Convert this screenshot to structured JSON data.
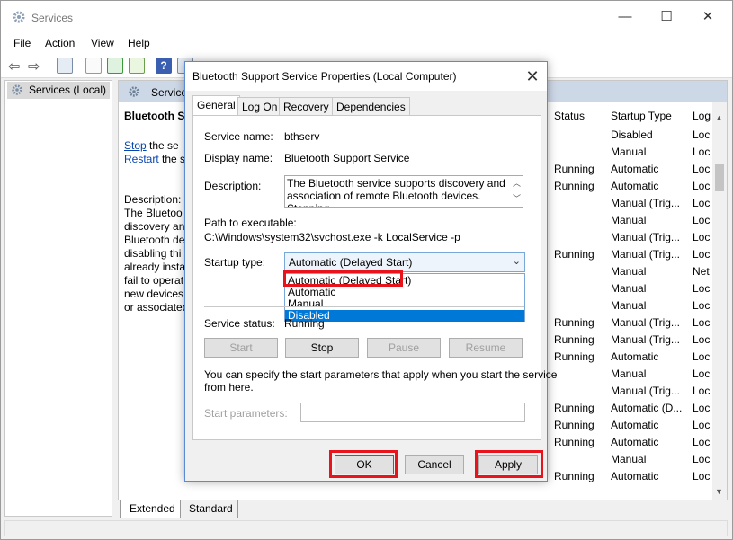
{
  "window": {
    "title": "Services",
    "minimize": "—",
    "maximize": "☐",
    "close": "✕"
  },
  "menu": [
    "File",
    "Action",
    "View",
    "Help"
  ],
  "tree": {
    "root_label": "Services (Local)"
  },
  "right_pane": {
    "header": "Services",
    "service_title": "Bluetooth S",
    "stop_link": "Stop",
    "stop_suffix": " the se",
    "restart_link": "Restart",
    "restart_suffix": " the se",
    "description_label": "Description:",
    "description_lines": [
      "The Bluetoo",
      "discovery an",
      "Bluetooth de",
      "disabling thi",
      "already insta",
      "fail to operat",
      "new devices",
      "or associated"
    ],
    "columns": {
      "status": "Status",
      "startup_type": "Startup Type",
      "log_on": "Log"
    },
    "rows": [
      {
        "status": "",
        "startup": "Disabled",
        "log": "Loc"
      },
      {
        "status": "",
        "startup": "Manual",
        "log": "Loc"
      },
      {
        "status": "Running",
        "startup": "Automatic",
        "log": "Loc"
      },
      {
        "status": "Running",
        "startup": "Automatic",
        "log": "Loc"
      },
      {
        "status": "",
        "startup": "Manual (Trig...",
        "log": "Loc"
      },
      {
        "status": "",
        "startup": "Manual",
        "log": "Loc"
      },
      {
        "status": "",
        "startup": "Manual (Trig...",
        "log": "Loc"
      },
      {
        "status": "Running",
        "startup": "Manual (Trig...",
        "log": "Loc"
      },
      {
        "status": "",
        "startup": "Manual",
        "log": "Net"
      },
      {
        "status": "",
        "startup": "Manual",
        "log": "Loc"
      },
      {
        "status": "",
        "startup": "Manual",
        "log": "Loc"
      },
      {
        "status": "Running",
        "startup": "Manual (Trig...",
        "log": "Loc"
      },
      {
        "status": "Running",
        "startup": "Manual (Trig...",
        "log": "Loc"
      },
      {
        "status": "Running",
        "startup": "Automatic",
        "log": "Loc"
      },
      {
        "status": "",
        "startup": "Manual",
        "log": "Loc"
      },
      {
        "status": "",
        "startup": "Manual (Trig...",
        "log": "Loc"
      },
      {
        "status": "Running",
        "startup": "Automatic (D...",
        "log": "Loc"
      },
      {
        "status": "Running",
        "startup": "Automatic",
        "log": "Loc"
      },
      {
        "status": "Running",
        "startup": "Automatic",
        "log": "Loc"
      },
      {
        "status": "",
        "startup": "Manual",
        "log": "Loc"
      },
      {
        "status": "Running",
        "startup": "Automatic",
        "log": "Loc"
      }
    ]
  },
  "bottom_tabs": [
    "Extended",
    "Standard"
  ],
  "dialog": {
    "title": "Bluetooth Support Service Properties (Local Computer)",
    "tabs": [
      "General",
      "Log On",
      "Recovery",
      "Dependencies"
    ],
    "service_name_label": "Service name:",
    "service_name_value": "bthserv",
    "display_name_label": "Display name:",
    "display_name_value": "Bluetooth Support Service",
    "description_label": "Description:",
    "description_value": "The Bluetooth service supports discovery and association of remote Bluetooth devices.  Stopping",
    "path_label": "Path to executable:",
    "path_value": "C:\\Windows\\system32\\svchost.exe -k LocalService -p",
    "startup_label": "Startup type:",
    "startup_selected": "Automatic (Delayed Start)",
    "startup_options": [
      "Automatic (Delayed Start)",
      "Automatic",
      "Manual",
      "Disabled"
    ],
    "status_label": "Service status:",
    "status_value": "Running",
    "buttons": {
      "start": "Start",
      "stop": "Stop",
      "pause": "Pause",
      "resume": "Resume"
    },
    "params_help": "You can specify the start parameters that apply when you start the service",
    "params_help2": "from here.",
    "params_label": "Start parameters:",
    "ok": "OK",
    "cancel": "Cancel",
    "apply": "Apply"
  },
  "colors": {
    "highlight": "#0078d7",
    "annotation_red": "#e8141c",
    "link": "#0645ad"
  }
}
